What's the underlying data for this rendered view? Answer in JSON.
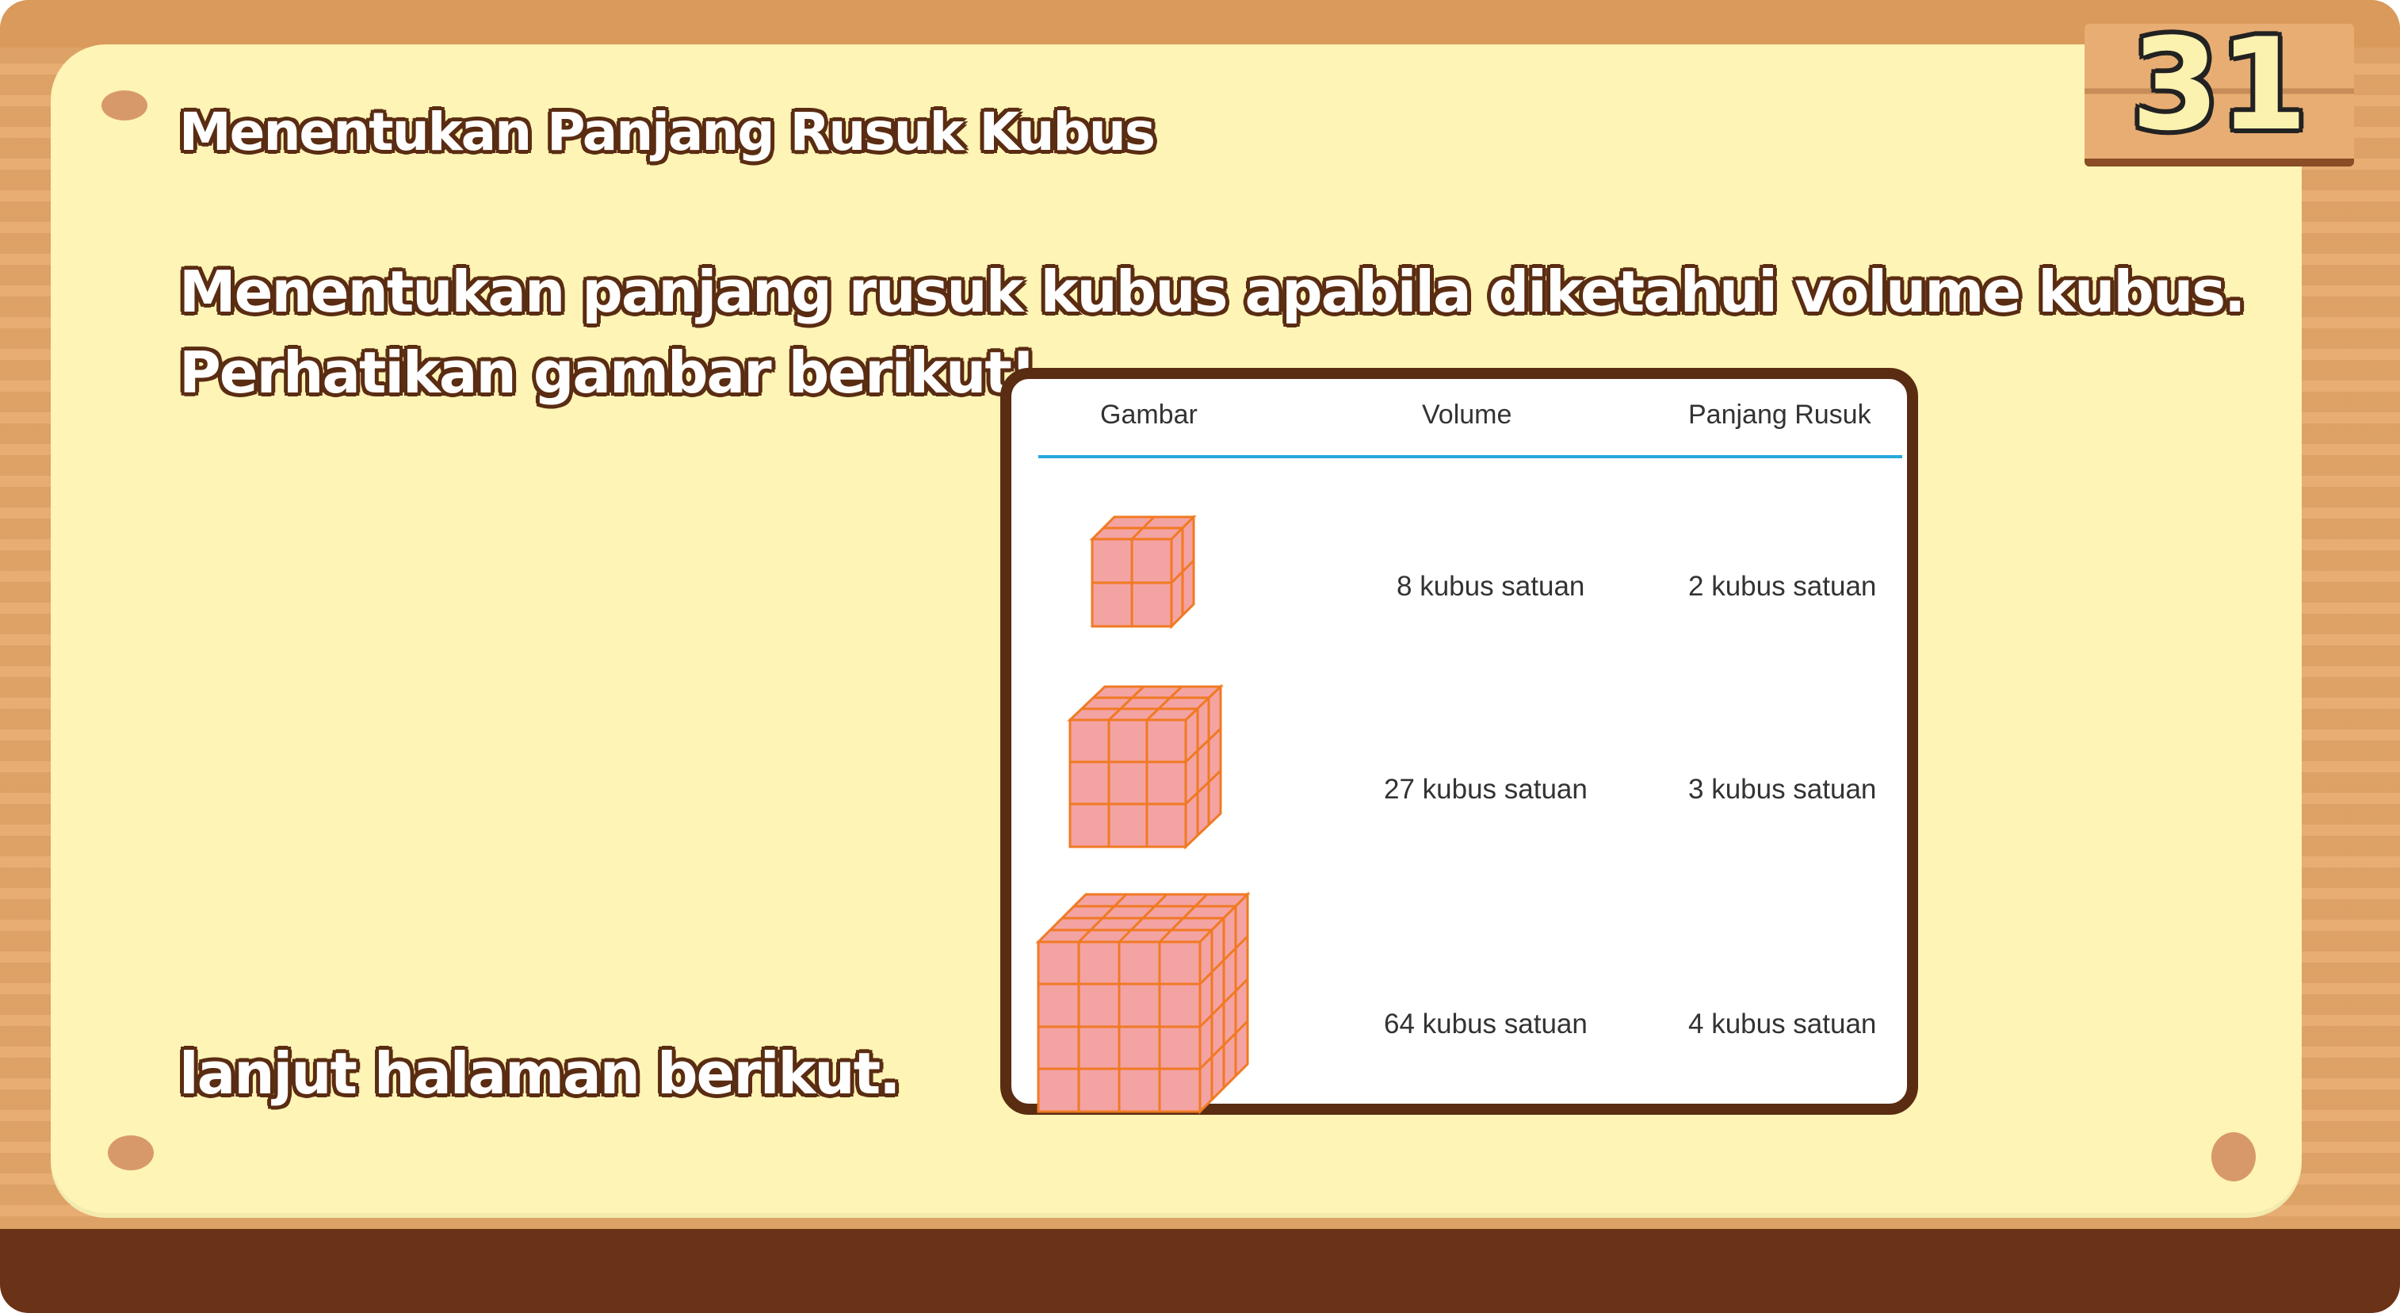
{
  "lesson": {
    "title": "Menentukan Panjang Rusuk Kubus",
    "line1": "Menentukan panjang rusuk kubus apabila diketahui volume kubus.",
    "line2": "Perhatikan gambar berikut!",
    "continue": "lanjut halaman berikut."
  },
  "page_number": "31",
  "table": {
    "headers": [
      "Gambar",
      "Volume",
      "Panjang Rusuk"
    ],
    "rows": [
      {
        "cube": "cube-2x2x2-icon",
        "volume": "8 kubus satuan",
        "edge": "2 kubus satuan"
      },
      {
        "cube": "cube-3x3x3-icon",
        "volume": "27 kubus satuan",
        "edge": "3 kubus satuan"
      },
      {
        "cube": "cube-4x4x4-icon",
        "volume": "64 kubus satuan",
        "edge": "4 kubus satuan"
      }
    ]
  },
  "colors": {
    "board": "#e6a86a",
    "paper": "#fdf4b5",
    "text_outline": "#5a2c12",
    "cube_fill": "#f4a3a3",
    "cube_line": "#f07a23",
    "header_rule": "#29a8dc"
  }
}
